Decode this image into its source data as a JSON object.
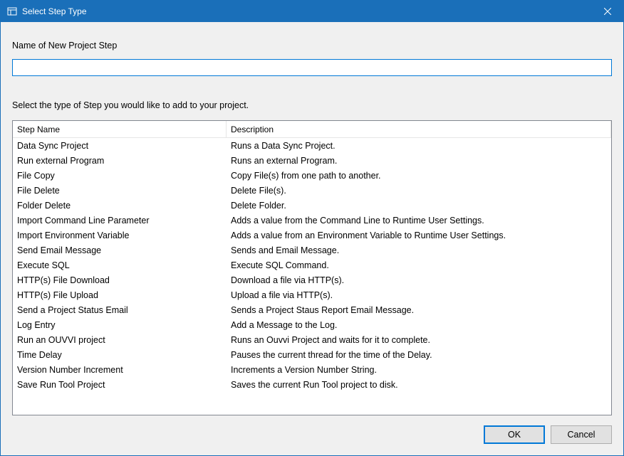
{
  "window": {
    "title": "Select Step Type",
    "icon": "app-icon",
    "close_label": "×"
  },
  "labels": {
    "name_prompt": "Name of New Project Step",
    "type_prompt": "Select the type of Step you would like to add to your project."
  },
  "name_input": {
    "value": ""
  },
  "columns": {
    "name": "Step Name",
    "description": "Description"
  },
  "steps": [
    {
      "name": "Data Sync Project",
      "description": "Runs a Data Sync Project."
    },
    {
      "name": "Run external Program",
      "description": "Runs an external Program."
    },
    {
      "name": "File Copy",
      "description": "Copy File(s) from one path to another."
    },
    {
      "name": "File Delete",
      "description": "Delete File(s)."
    },
    {
      "name": "Folder Delete",
      "description": "Delete Folder."
    },
    {
      "name": "Import Command Line Parameter",
      "description": "Adds a value from the Command Line to Runtime User Settings."
    },
    {
      "name": "Import Environment Variable",
      "description": "Adds a value from an Environment Variable to Runtime User Settings."
    },
    {
      "name": "Send Email Message",
      "description": "Sends and Email Message."
    },
    {
      "name": "Execute SQL",
      "description": "Execute SQL Command."
    },
    {
      "name": "HTTP(s) File Download",
      "description": "Download a file via HTTP(s)."
    },
    {
      "name": "HTTP(s) File Upload",
      "description": "Upload a file via HTTP(s)."
    },
    {
      "name": "Send a Project Status Email",
      "description": "Sends a Project Staus Report Email Message."
    },
    {
      "name": "Log Entry",
      "description": "Add a Message to the Log."
    },
    {
      "name": "Run an OUVVI project",
      "description": "Runs an Ouvvi Project and waits for it to complete."
    },
    {
      "name": "Time Delay",
      "description": "Pauses the current thread for the time of the Delay."
    },
    {
      "name": "Version Number Increment",
      "description": "Increments a Version Number String."
    },
    {
      "name": "Save Run Tool Project",
      "description": "Saves the current Run Tool project to disk."
    }
  ],
  "buttons": {
    "ok": "OK",
    "cancel": "Cancel"
  }
}
